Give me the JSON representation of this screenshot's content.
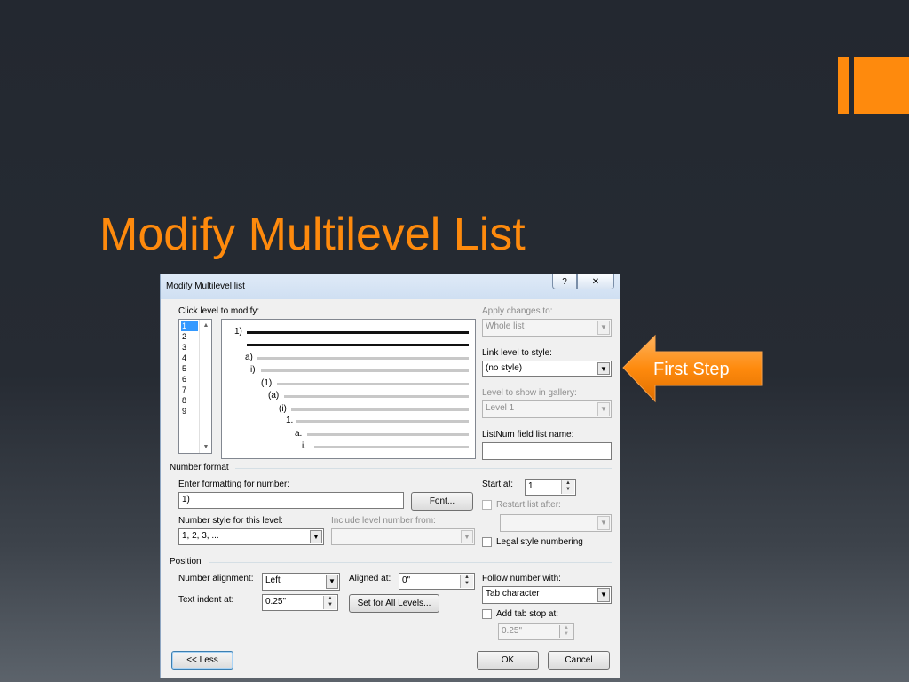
{
  "slide": {
    "title": "Modify Multilevel List",
    "accent_color": "#fe8a0d",
    "background_color": "#262b33"
  },
  "dialog": {
    "title": "Modify Multilevel list",
    "help_label": "?",
    "close_label": "✕",
    "click_level_label": "Click level to modify:",
    "levels": [
      "1",
      "2",
      "3",
      "4",
      "5",
      "6",
      "7",
      "8",
      "9"
    ],
    "selected_level": "1",
    "preview_labels": [
      "1)",
      "a)",
      "i)",
      "(1)",
      "(a)",
      "(i)",
      "1.",
      "a.",
      "i."
    ],
    "apply_changes_label": "Apply changes to:",
    "apply_changes_value": "Whole list",
    "link_level_label": "Link level to style:",
    "link_level_value": "(no style)",
    "gallery_level_label": "Level to show in gallery:",
    "gallery_level_value": "Level 1",
    "listnum_label": "ListNum field list name:",
    "listnum_value": "",
    "number_format_section": "Number format",
    "enter_formatting_label": "Enter formatting for number:",
    "formatting_value": "1)",
    "font_button": "Font...",
    "start_at_label": "Start at:",
    "start_at_value": "1",
    "restart_list_label": "Restart list after:",
    "restart_list_value": "",
    "number_style_label": "Number style for this level:",
    "number_style_value": "1, 2, 3, ...",
    "include_level_label": "Include level number from:",
    "include_level_value": "",
    "legal_style_label": "Legal style numbering",
    "position_section": "Position",
    "number_alignment_label": "Number alignment:",
    "number_alignment_value": "Left",
    "aligned_at_label": "Aligned at:",
    "aligned_at_value": "0\"",
    "follow_number_label": "Follow number with:",
    "follow_number_value": "Tab character",
    "text_indent_label": "Text indent at:",
    "text_indent_value": "0.25\"",
    "set_all_levels_button": "Set for All Levels...",
    "add_tab_stop_label": "Add tab stop at:",
    "tab_stop_value": "0.25\"",
    "less_button": "<< Less",
    "ok_button": "OK",
    "cancel_button": "Cancel"
  },
  "annotation": {
    "text": "First Step",
    "color": "#fe8a0d"
  }
}
